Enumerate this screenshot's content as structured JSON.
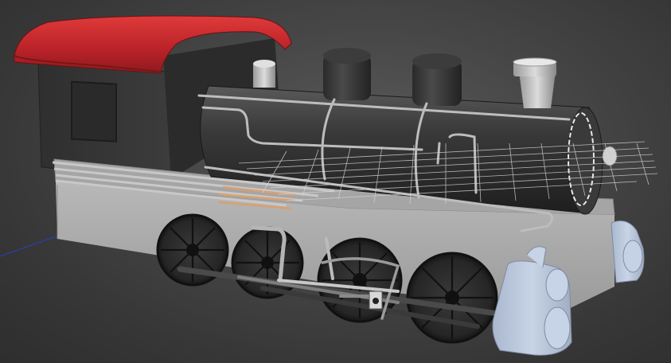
{
  "viewport": {
    "background": "#4a4a4a",
    "object_name": "steam-locomotive",
    "colors": {
      "cab_roof": "#c8262c",
      "body": "#333333",
      "frame": "#a9a9a9",
      "wheels": "#2a2a2a",
      "cylinders": "#b9c7dc",
      "pipes": "#b8b8b8",
      "grid": "#d8d8d8",
      "axis_line": "#2a3fa0",
      "highlight": "#d9a070"
    }
  }
}
